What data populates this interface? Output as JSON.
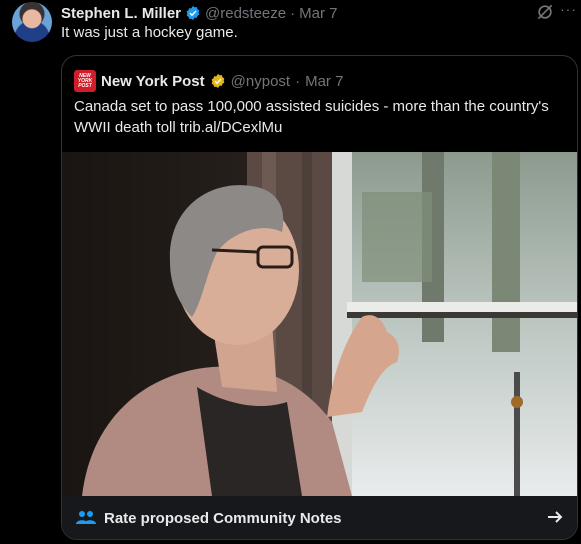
{
  "tweet": {
    "author_name": "Stephen L. Miller",
    "handle": "@redsteeze",
    "separator": "·",
    "date": "Mar 7",
    "text": "It was just a hockey game."
  },
  "quoted": {
    "author_name": "New York Post",
    "handle": "@nypost",
    "separator": "·",
    "date": "Mar 7",
    "logo_text": [
      "NEW",
      "YORK",
      "POST"
    ],
    "text": "Canada set to pass 100,000 assisted suicides - more than the country's WWII death toll trib.al/DCexlMu"
  },
  "community_notes": {
    "label": "Rate proposed Community Notes",
    "icon": "people-icon",
    "arrow_icon": "arrow-right-icon"
  },
  "colors": {
    "background": "#000000",
    "text": "#e7e9ea",
    "muted": "#71767b",
    "verified_blue": "#1d9bf0",
    "verified_gold": "#e2b719",
    "nyp_red": "#cf1d2a",
    "border": "#2f3336"
  }
}
